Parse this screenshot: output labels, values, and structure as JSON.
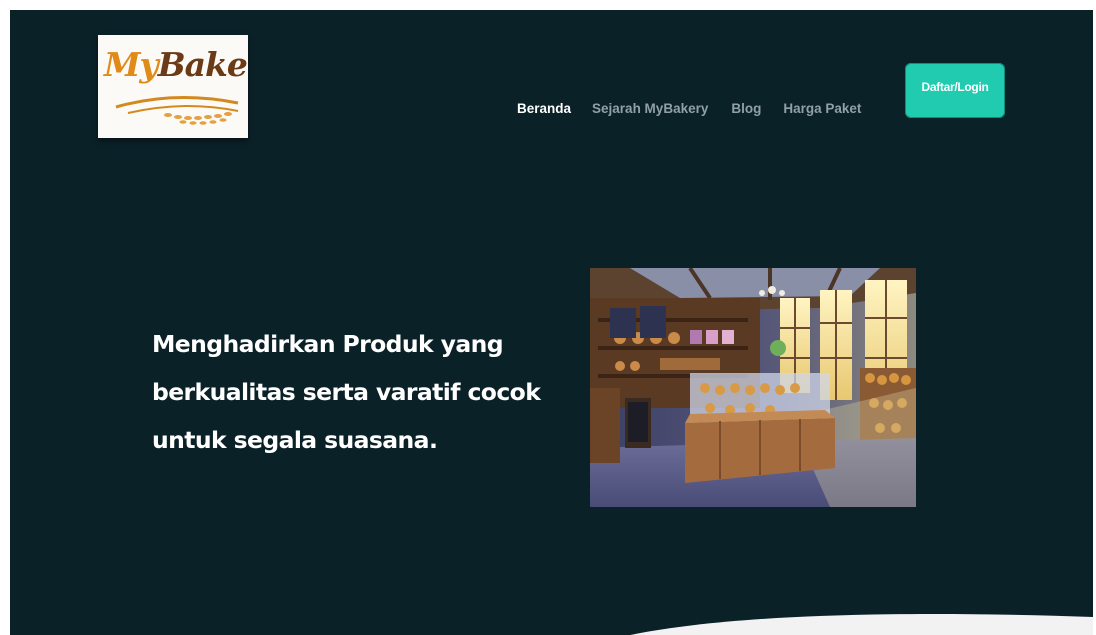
{
  "brand": {
    "logo_text_my": "My",
    "logo_text_bakery": "Bakery"
  },
  "nav": {
    "items": [
      "Beranda",
      "Sejarah MyBakery",
      "Blog",
      "Harga Paket"
    ],
    "active": "Beranda",
    "cta_label": "Daftar/Login"
  },
  "hero": {
    "lines": [
      "Menghadirkan Produk yang",
      "berkualitas serta varatif cocok",
      "untuk segala suasana."
    ],
    "image_icon": "bakery-interior-image"
  },
  "colors": {
    "background": "#0b2128",
    "accent": "#21cbb0",
    "nav_active": "#ffffff",
    "nav_inactive": "#8fa0a6"
  }
}
